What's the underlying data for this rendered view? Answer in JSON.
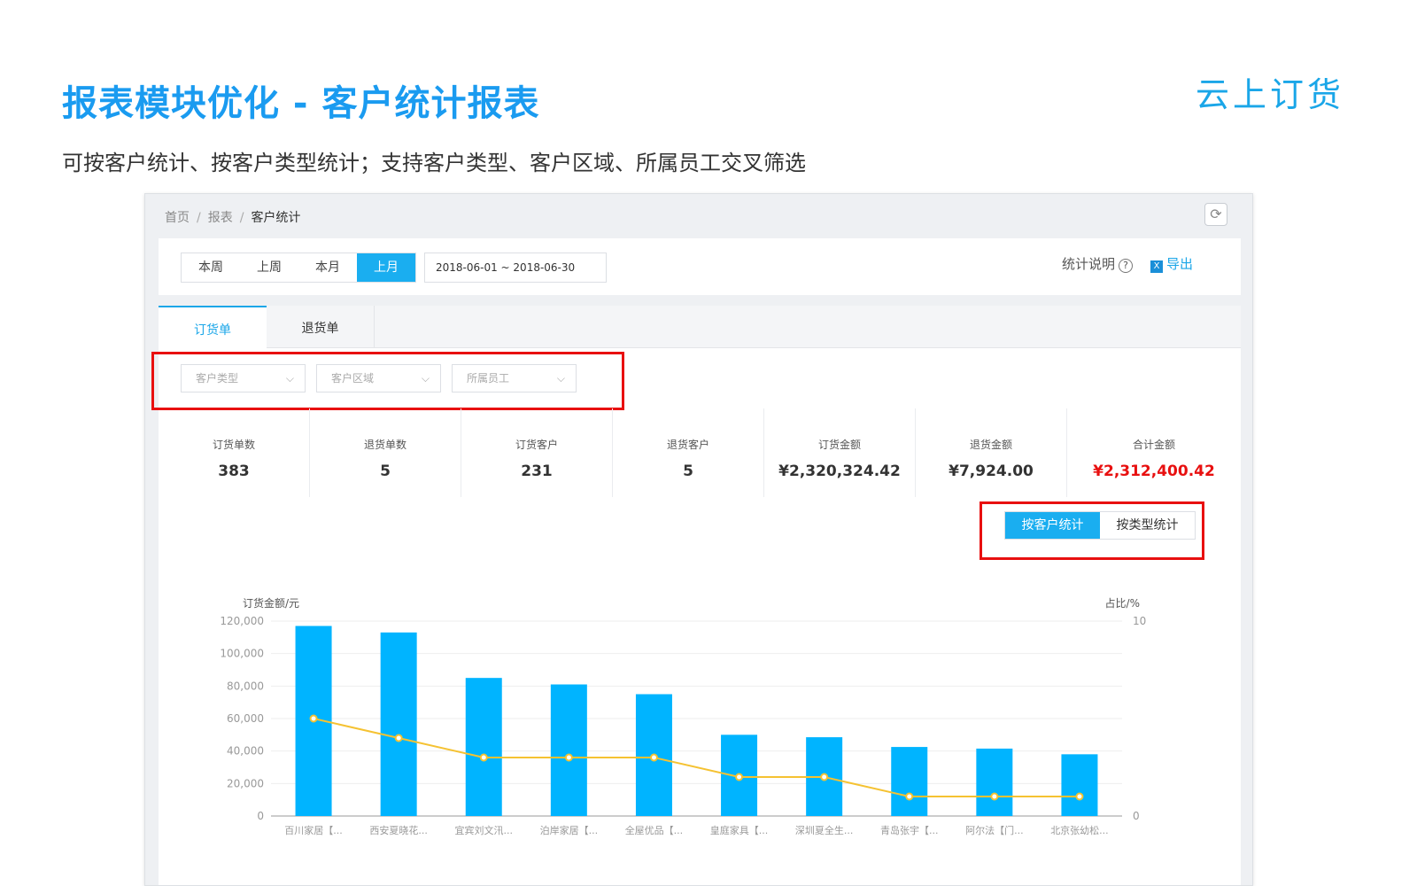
{
  "slide": {
    "title": "报表模块优化 - 客户统计报表",
    "subtitle": "可按客户统计、按客户类型统计；支持客户类型、客户区域、所属员工交叉筛选",
    "logo": "云上订货"
  },
  "breadcrumb": [
    "首页",
    "报表",
    "客户统计"
  ],
  "toolbar": {
    "periods": [
      "本周",
      "上周",
      "本月",
      "上月"
    ],
    "active_period": "上月",
    "date_range": "2018-06-01 ~ 2018-06-30",
    "help_label": "统计说明",
    "export_label": "导出"
  },
  "tabs": [
    {
      "label": "订货单",
      "active": true
    },
    {
      "label": "退货单",
      "active": false
    }
  ],
  "filters": [
    {
      "placeholder": "客户类型"
    },
    {
      "placeholder": "客户区域"
    },
    {
      "placeholder": "所属员工"
    }
  ],
  "stats": [
    {
      "label": "订货单数",
      "value": "383",
      "highlight": false
    },
    {
      "label": "退货单数",
      "value": "5",
      "highlight": false
    },
    {
      "label": "订货客户",
      "value": "231",
      "highlight": false
    },
    {
      "label": "退货客户",
      "value": "5",
      "highlight": false
    },
    {
      "label": "订货金额",
      "value": "¥2,320,324.42",
      "highlight": false
    },
    {
      "label": "退货金额",
      "value": "¥7,924.00",
      "highlight": false
    },
    {
      "label": "合计金额",
      "value": "¥2,312,400.42",
      "highlight": true
    }
  ],
  "view_toggle": {
    "options": [
      "按客户统计",
      "按类型统计"
    ],
    "active": "按客户统计"
  },
  "colors": {
    "accent": "#1aaef0",
    "bar": "#00b4ff",
    "line": "#f5c232",
    "highlight_red": "#e81010"
  },
  "chart_data": {
    "type": "bar",
    "categories": [
      "百川家居【...",
      "西安夏晓花...",
      "宜宾刘文汛...",
      "泊岸家居【...",
      "全屋优品【...",
      "皇庭家具【...",
      "深圳夏全生...",
      "青岛张宇【...",
      "阿尔法【门...",
      "北京张幼松..."
    ],
    "series": [
      {
        "axis": "left",
        "values": [
          117000,
          113000,
          85000,
          81000,
          75000,
          50000,
          48500,
          42500,
          41500,
          38000
        ]
      },
      {
        "axis": "right",
        "type": "line",
        "values": [
          5,
          4,
          3,
          3,
          3,
          2,
          2,
          1,
          1,
          1
        ]
      }
    ],
    "ylabel": "订货金额/元",
    "y2label": "占比/%",
    "ylim": [
      0,
      120000
    ],
    "y_ticks": [
      "0",
      "20,000",
      "40,000",
      "60,000",
      "80,000",
      "100,000",
      "120,000"
    ],
    "y2lim": [
      0,
      10
    ],
    "y2_ticks": [
      "0",
      "10"
    ],
    "grid": true
  }
}
